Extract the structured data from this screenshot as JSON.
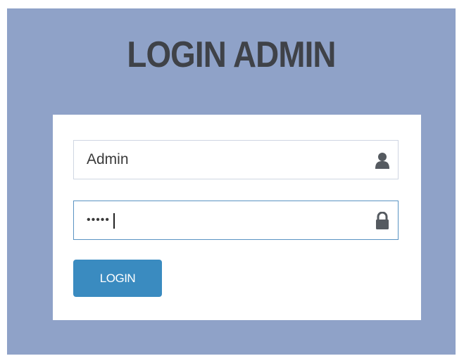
{
  "page": {
    "title": "LOGIN ADMIN",
    "background_color": "#8fa2c8"
  },
  "form": {
    "username": {
      "value": "Admin",
      "icon": "user-icon"
    },
    "password": {
      "value": "•••••",
      "icon": "lock-icon",
      "focused": true
    },
    "submit_label": "LOGIN",
    "accent_color": "#3a8bc0"
  }
}
